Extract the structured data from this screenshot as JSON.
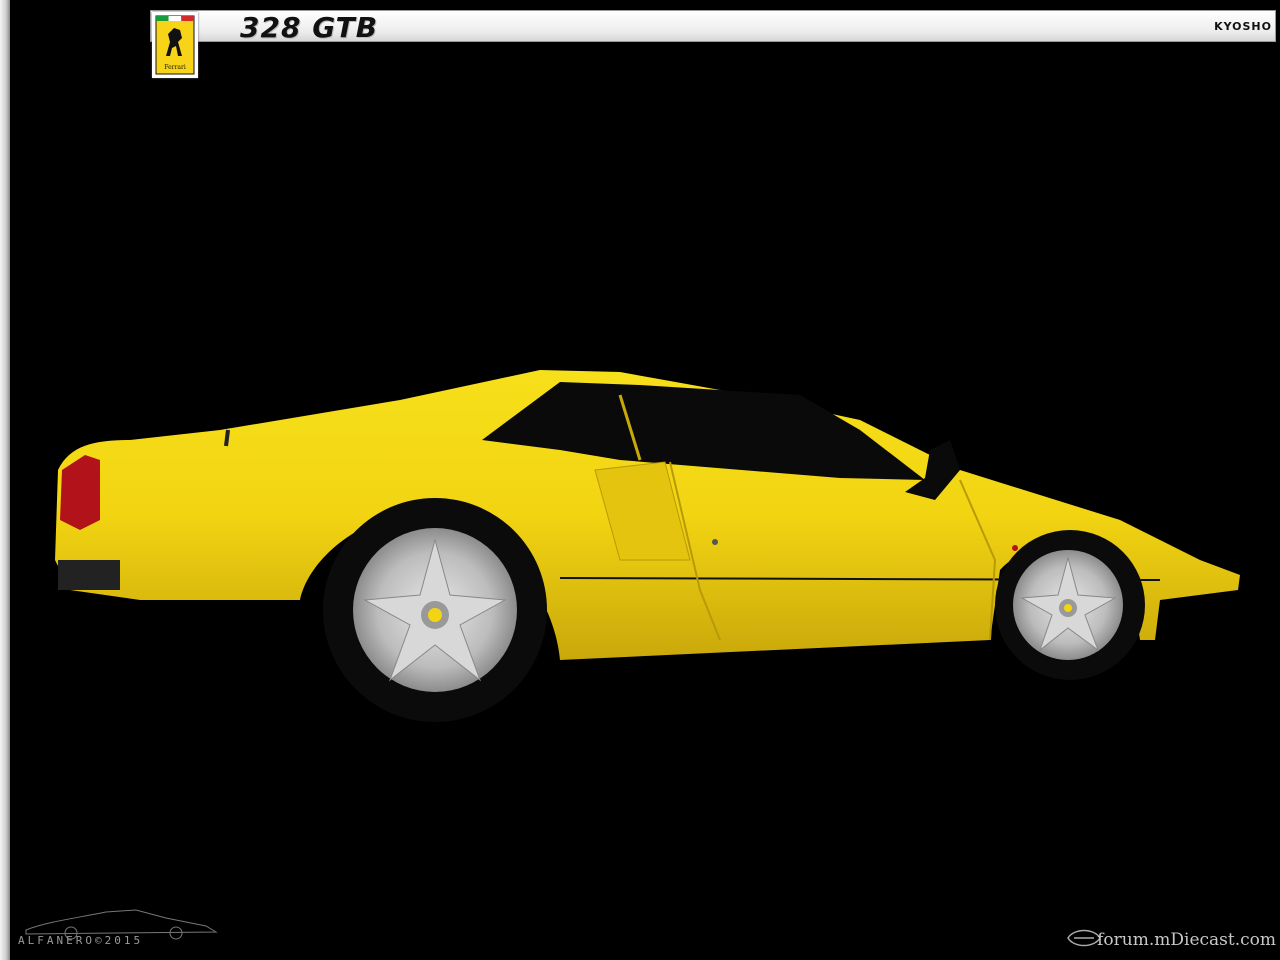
{
  "header": {
    "title": "328 GTB",
    "brand": "KYOSHO",
    "logo_text": "Ferrari"
  },
  "photo": {
    "subject": "yellow sports car side profile",
    "body_color": "#f2d412",
    "background_color": "#000000"
  },
  "watermarks": {
    "signature": "ALFANERO©2015",
    "forum": "forum.mDiecast.com"
  },
  "icons": [
    "prancing-horse-logo-icon",
    "car-silhouette-icon",
    "mdiecast-logo-icon"
  ]
}
